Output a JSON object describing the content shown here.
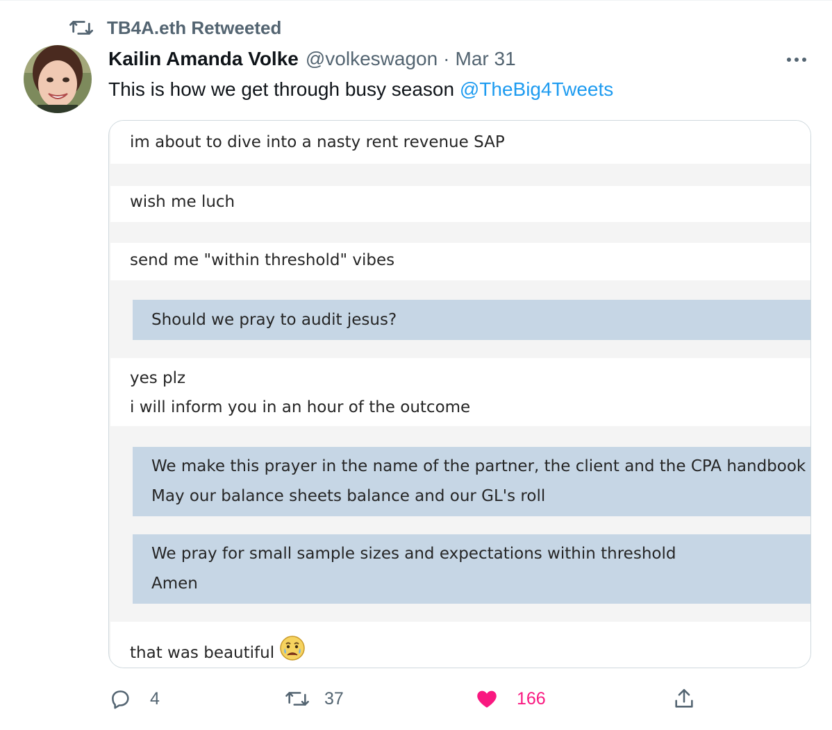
{
  "retweet_context": {
    "icon": "retweet-icon",
    "text": "TB4A.eth Retweeted"
  },
  "tweet": {
    "author_name": "Kailin Amanda Volke",
    "handle": "@volkeswagon",
    "separator": "·",
    "date": "Mar 31",
    "text": "This is how we get through busy season ",
    "mention": "@TheBig4Tweets",
    "more_icon": "more-icon"
  },
  "media": {
    "messages": [
      {
        "type": "sent",
        "lines": [
          "im about to dive into a nasty rent revenue SAP"
        ]
      },
      {
        "type": "sent",
        "lines": [
          "wish me luch"
        ]
      },
      {
        "type": "sent",
        "lines": [
          "send me \"within threshold\" vibes"
        ]
      },
      {
        "type": "reply",
        "lines": [
          "Should we pray to audit jesus?"
        ]
      },
      {
        "type": "sent",
        "lines": [
          "yes plz",
          "i will inform you in an hour of the outcome"
        ]
      },
      {
        "type": "reply",
        "lines": [
          "We make this prayer in the name of the partner, the client and the CPA handbook",
          "May our balance sheets balance and our GL's roll"
        ]
      },
      {
        "type": "reply",
        "lines": [
          "We pray for small sample sizes and expectations within threshold",
          "Amen"
        ]
      },
      {
        "type": "sent",
        "lines": [
          "that was beautiful"
        ],
        "emoji": "crying-face-emoji"
      }
    ]
  },
  "actions": {
    "reply": {
      "icon": "reply-icon",
      "count": "4"
    },
    "retweet": {
      "icon": "retweet-icon",
      "count": "37"
    },
    "like": {
      "icon": "heart-icon",
      "count": "166",
      "active": true,
      "color": "#f91880"
    },
    "share": {
      "icon": "share-icon"
    }
  },
  "colors": {
    "accent": "#1d9bf0",
    "secondary_text": "#536471",
    "reply_bubble": "#c6d6e5"
  }
}
